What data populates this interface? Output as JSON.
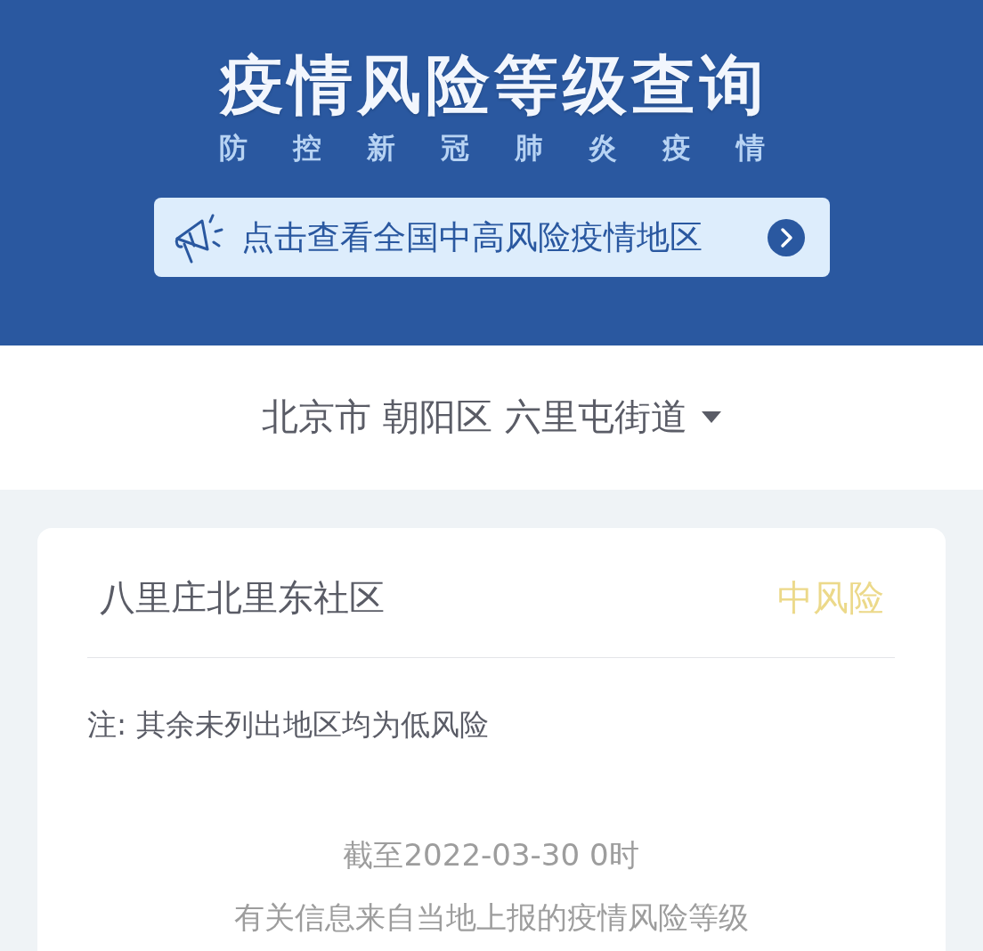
{
  "header": {
    "title": "疫情风险等级查询",
    "subtitle": "防控新冠肺炎疫情",
    "banner_link": "点击查看全国中高风险疫情地区"
  },
  "location_selector": {
    "value": "北京市 朝阳区 六里屯街道"
  },
  "areas": [
    {
      "name": "八里庄北里东社区",
      "risk": "中风险",
      "kind": "medium"
    }
  ],
  "note": "注: 其余未列出地区均为低风险",
  "footer": [
    "截至2022-03-30 0时",
    "有关信息来自当地上报的疫情风险等级"
  ]
}
